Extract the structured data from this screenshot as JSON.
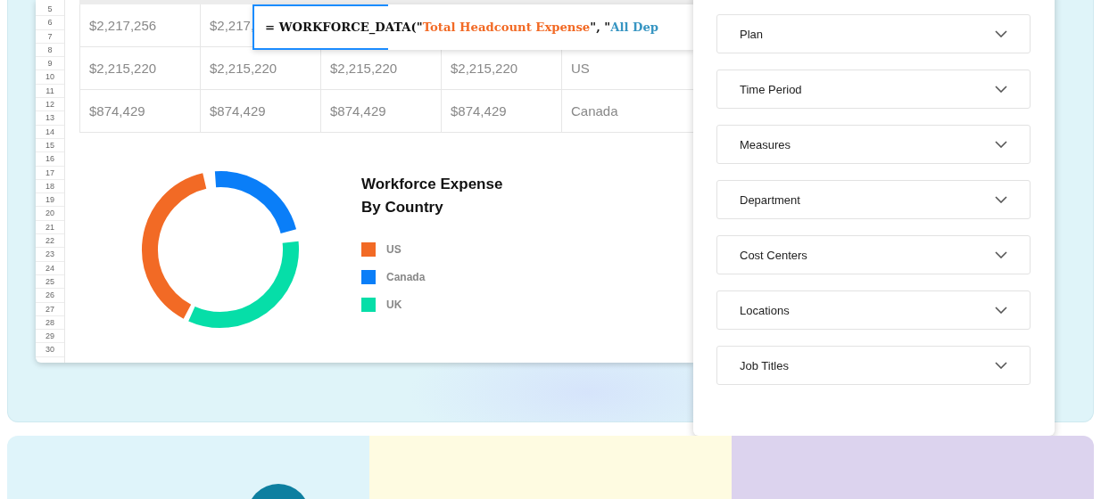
{
  "sheet": {
    "row_numbers": [
      "5",
      "6",
      "7",
      "8",
      "9",
      "10",
      "11",
      "12",
      "13",
      "14",
      "15",
      "16",
      "17",
      "18",
      "19",
      "20",
      "21",
      "22",
      "23",
      "24",
      "25",
      "26",
      "27",
      "28",
      "29",
      "30"
    ],
    "rows": [
      [
        "$2,217,256",
        "$2,217,"
      ],
      [
        "$2,215,220",
        "$2,215,220",
        "$2,215,220",
        "$2,215,220",
        "US"
      ],
      [
        "$874,429",
        "$874,429",
        "$874,429",
        "$874,429",
        "Canada"
      ]
    ],
    "formula": [
      {
        "kind": "plain",
        "text": "= WORKFORCE_DATA(\""
      },
      {
        "kind": "argument",
        "text": "Total Headcount Expense",
        "color": "#f26a25"
      },
      {
        "kind": "plain",
        "text": "\", \""
      },
      {
        "kind": "argument",
        "text": "All Dep",
        "color": "#3795c2"
      }
    ],
    "chart": {
      "title": "Workforce Expense By Country",
      "legend": [
        {
          "label": "US",
          "color": "#f26a25"
        },
        {
          "label": "Canada",
          "color": "#0a7ef8"
        },
        {
          "label": "UK",
          "color": "#06dea8"
        }
      ]
    }
  },
  "filters": [
    {
      "label": "Plan"
    },
    {
      "label": "Time Period"
    },
    {
      "label": "Measures"
    },
    {
      "label": "Department"
    },
    {
      "label": "Cost Centers"
    },
    {
      "label": "Locations"
    },
    {
      "label": "Job Titles"
    }
  ]
}
